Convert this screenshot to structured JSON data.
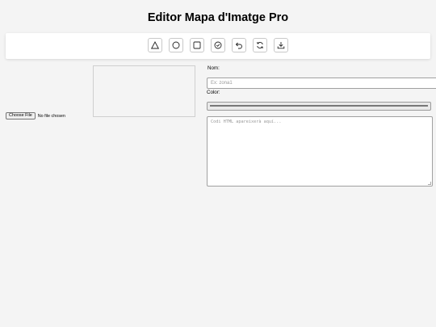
{
  "app": {
    "title": "Editor Mapa d'Imatge Pro"
  },
  "toolbar": {
    "tools": [
      {
        "icon": "triangle-icon",
        "name": "polygon-tool-button"
      },
      {
        "icon": "circle-icon",
        "name": "circle-tool-button"
      },
      {
        "icon": "square-icon",
        "name": "rectangle-tool-button"
      },
      {
        "icon": "check-circle-icon",
        "name": "confirm-button"
      },
      {
        "icon": "undo-icon",
        "name": "undo-button"
      },
      {
        "icon": "refresh-icon",
        "name": "reset-button"
      },
      {
        "icon": "download-icon",
        "name": "download-button"
      }
    ]
  },
  "file": {
    "button_label": "Choose File",
    "status": "No file chosen"
  },
  "form": {
    "name_label": "Nom:",
    "name_placeholder": "Ex: zona1",
    "color_label": "Color:",
    "code_placeholder": "Codi HTML apareixerà aquí..."
  }
}
